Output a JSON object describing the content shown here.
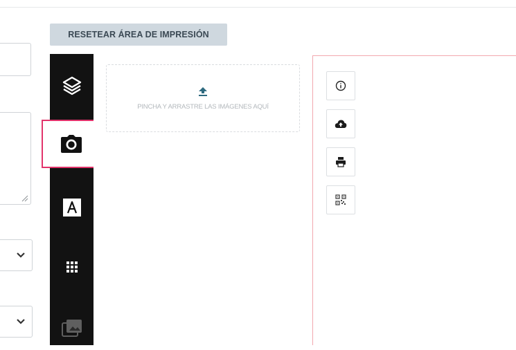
{
  "toolbar_top": {
    "reset_label": "RESETEAR ÁREA DE IMPRESIÓN"
  },
  "sidebar_tools": [
    {
      "icon": "layers-icon",
      "active": false
    },
    {
      "icon": "camera-icon",
      "active": true
    },
    {
      "icon": "text-icon",
      "active": false,
      "glyph": "A"
    },
    {
      "icon": "grid-pattern-icon",
      "active": false
    },
    {
      "icon": "image-gallery-icon",
      "active": false
    }
  ],
  "upload": {
    "icon": "upload-icon",
    "instruction": "PINCHA Y ARRASTRE LAS IMÁGENES AQUÍ"
  },
  "canvas_actions": [
    {
      "icon": "info-icon"
    },
    {
      "icon": "cloud-upload-icon"
    },
    {
      "icon": "print-icon"
    },
    {
      "icon": "qr-code-icon"
    }
  ],
  "colors": {
    "accent": "#e2336b",
    "toolbar_bg": "#121212",
    "reset_bg": "#cfd8df",
    "canvas_border": "#f2a7ae"
  }
}
